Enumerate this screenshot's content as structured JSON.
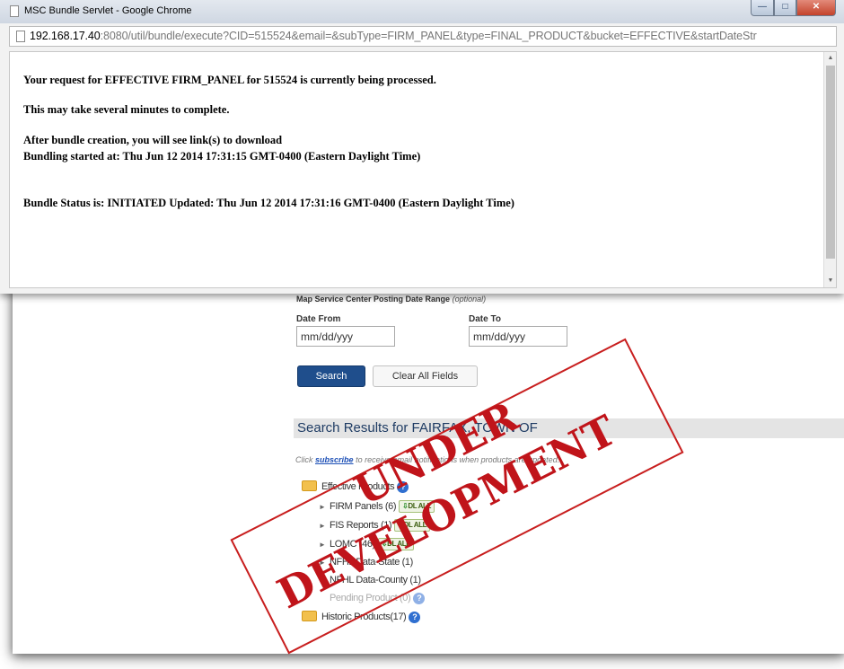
{
  "popup": {
    "title": "MSC Bundle Servlet - Google Chrome",
    "url_host": "192.168.17.40",
    "url_rest": ":8080/util/bundle/execute?CID=515524&email=&subType=FIRM_PANEL&type=FINAL_PRODUCT&bucket=EFFECTIVE&startDateStr",
    "window_buttons": {
      "minimize": "—",
      "maximize": "□",
      "close": "✕"
    },
    "scroll_up": "▲",
    "scroll_down": "▼",
    "messages": [
      "Your request for EFFECTIVE FIRM_PANEL for 515524 is currently being processed.",
      "This may take several minutes to complete.",
      "After bundle creation, you will see link(s) to download",
      "Bundling started at: Thu Jun 12 2014 17:31:15 GMT-0400 (Eastern Daylight Time)",
      "Bundle Status is: INITIATED Updated: Thu Jun 12 2014 17:31:16 GMT-0400 (Eastern Daylight Time)"
    ]
  },
  "search_form": {
    "date_range_label": "Map Service Center Posting Date Range",
    "date_range_optional": "(optional)",
    "date_from_label": "Date From",
    "date_to_label": "Date To",
    "date_from_placeholder": "mm/dd/yyy",
    "date_to_placeholder": "mm/dd/yyy",
    "search_button": "Search",
    "clear_button": "Clear All Fields"
  },
  "results": {
    "header": "Search Results for FAIRFAX, TOWN OF",
    "subscribe_prefix": "Click",
    "subscribe_link": "subscribe",
    "subscribe_suffix": "to receive email notifications when products are updated.",
    "tree": {
      "effective_products": "Effective Products",
      "help_glyph": "?",
      "dl_all": "DL ALL",
      "dl_glyph": "⇩",
      "caret": "►",
      "items": [
        {
          "label": "FIRM Panels",
          "count": "(6)",
          "dl": true
        },
        {
          "label": "FIS Reports",
          "count": "(1)",
          "dl": true
        },
        {
          "label": "LOMC",
          "count": "(46)",
          "dl": true
        },
        {
          "label": "NFHL Data-State",
          "count": "(1)",
          "dl": false
        },
        {
          "label": "NFHL Data-County",
          "count": "(1)",
          "dl": false
        },
        {
          "label": "Pending Product",
          "count": "(0)",
          "dl": false
        }
      ],
      "historic_products": "Historic Products",
      "historic_count": "(17)"
    }
  },
  "watermark": {
    "line1": "UNDER",
    "line2": "DEVELOPMENT",
    "color": "#c0141a"
  }
}
